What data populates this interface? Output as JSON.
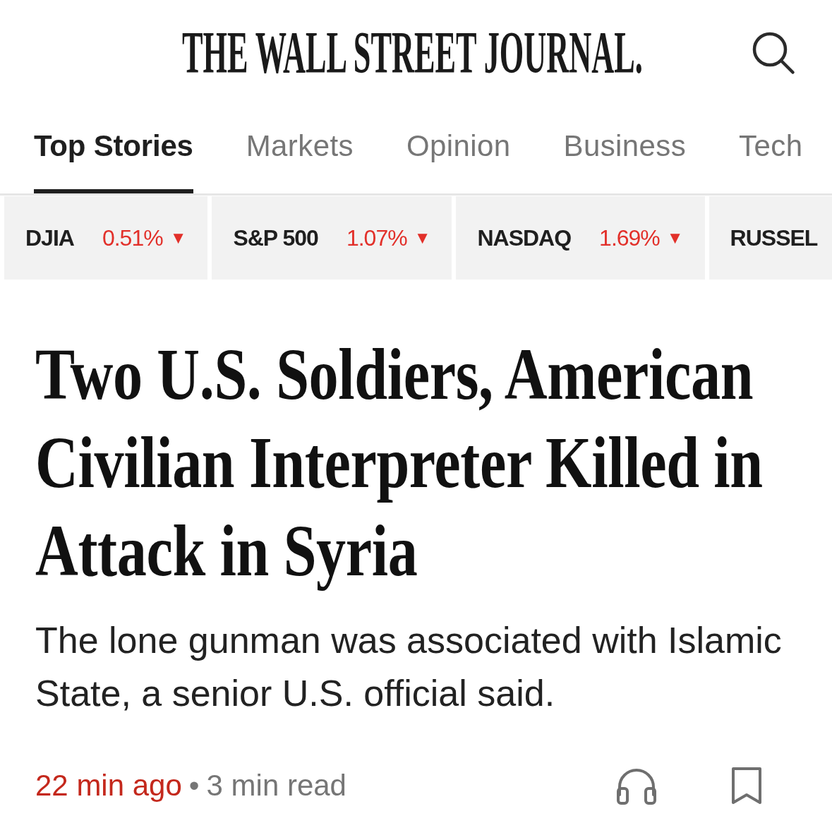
{
  "masthead": {
    "title": "THE WALL STREET JOURNAL."
  },
  "tabs": [
    {
      "label": "Top Stories",
      "selected": true
    },
    {
      "label": "Markets",
      "selected": false
    },
    {
      "label": "Opinion",
      "selected": false
    },
    {
      "label": "Business",
      "selected": false
    },
    {
      "label": "Tech",
      "selected": false
    }
  ],
  "tickers": [
    {
      "name": "DJIA",
      "change": "0.51%",
      "arrow": "▼",
      "down": true
    },
    {
      "name": "S&P 500",
      "change": "1.07%",
      "arrow": "▼",
      "down": true
    },
    {
      "name": "NASDAQ",
      "change": "1.69%",
      "arrow": "▼",
      "down": true
    },
    {
      "name": "RUSSEL"
    }
  ],
  "article": {
    "headline": "Two U.S. Soldiers, American Civilian Interpreter Killed in Attack in Syria",
    "summary": "The lone gunman was associated with Islamic State, a senior U.S. official said.",
    "time": "22 min ago",
    "separator": "•",
    "read_time": "3 min read",
    "saved": false
  }
}
